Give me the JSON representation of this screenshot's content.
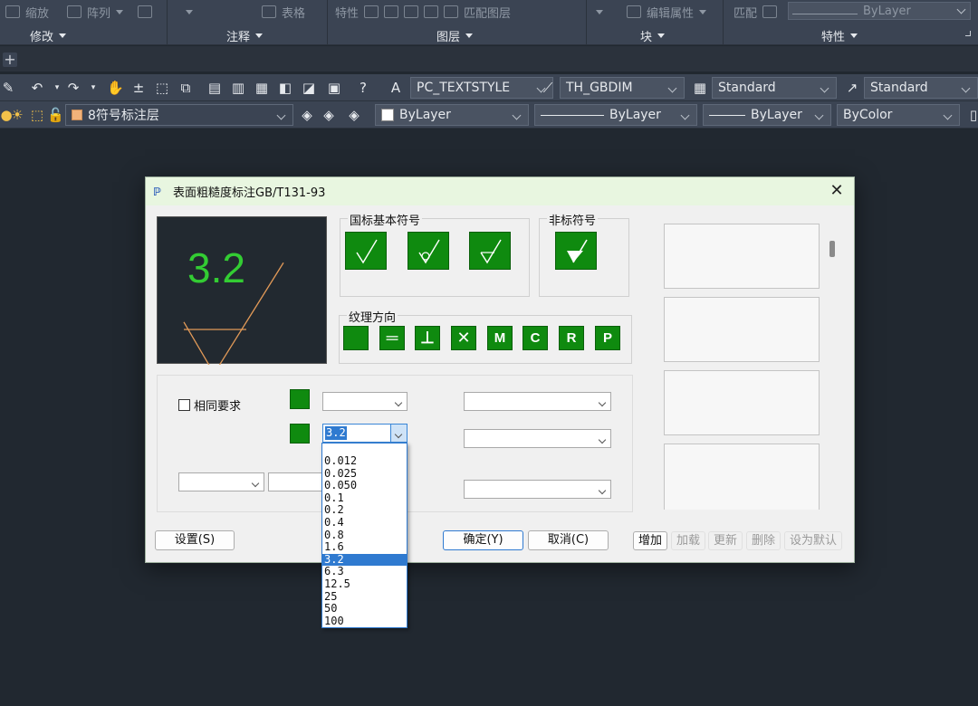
{
  "ribbon": {
    "top_items": [
      "缩放",
      "阵列",
      "表格",
      "特性",
      "匹配图层",
      "编辑属性",
      "匹配"
    ],
    "bylayer_value": "ByLayer",
    "panels": [
      "修改",
      "注释",
      "图层",
      "块",
      "特性"
    ]
  },
  "toolbar1": {
    "text_style": "PC_TEXTSTYLE",
    "dim_style": "TH_GBDIM",
    "table_style": "Standard",
    "multileader_style": "Standard"
  },
  "toolbar2": {
    "layer": "8符号标注层",
    "color": "ByLayer",
    "linetype": "ByLayer",
    "lineweight": "ByLayer",
    "plot_style": "ByColor"
  },
  "dialog": {
    "title": "表面粗糙度标注GB/T131-93",
    "preview_value": "3.2",
    "group_basic": "国标基本符号",
    "group_nonstd": "非标符号",
    "group_texture": "纹理方向",
    "texture_buttons": [
      "",
      "═",
      "⊥",
      "✕",
      "M",
      "C",
      "R",
      "P"
    ],
    "same_requirement": "相同要求",
    "selected_value": "3.2",
    "buttons": {
      "settings": "设置(S)",
      "ok": "确定(Y)",
      "cancel": "取消(C)",
      "add": "增加",
      "load": "加载",
      "update": "更新",
      "delete": "删除",
      "set_default": "设为默认"
    },
    "dropdown_options": [
      "0.012",
      "0.025",
      "0.050",
      "0.1",
      "0.2",
      "0.4",
      "0.8",
      "1.6",
      "3.2",
      "6.3",
      "12.5",
      "25",
      "50",
      "100"
    ],
    "dropdown_selected": "3.2"
  },
  "colors": {
    "green": "#0f8a0f",
    "accent": "#2f7ad0",
    "bg": "#212830"
  }
}
